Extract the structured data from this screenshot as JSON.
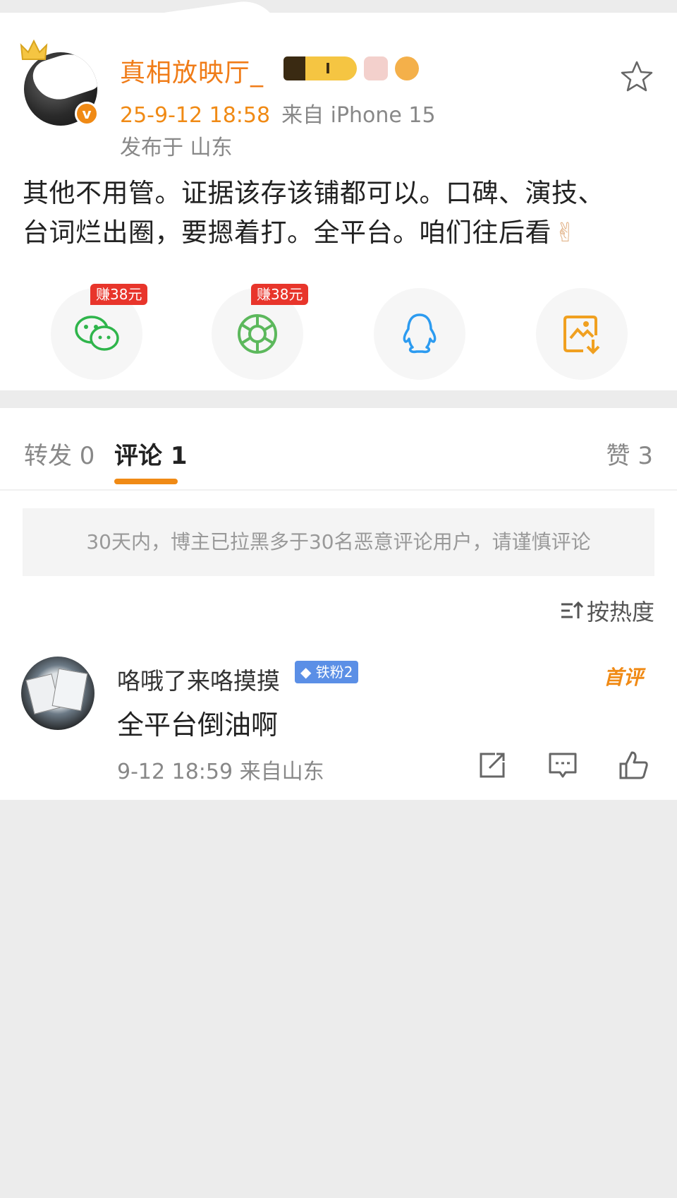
{
  "post": {
    "username": "真相放映厅_",
    "level_badge": "I",
    "verified_mark": "v",
    "time": "25-9-12 18:58",
    "source": "来自 iPhone 15",
    "location": "发布于 山东",
    "text_line1": "其他不用管。证据该存该铺都可以。口碑、演技、",
    "text_line2": "台词烂出圈，要摁着打。全平台。咱们往后看",
    "emoji": "✌"
  },
  "share": {
    "items": [
      {
        "icon": "wechat-icon",
        "tag": "赚38元"
      },
      {
        "icon": "moments-icon",
        "tag": "赚38元"
      },
      {
        "icon": "qq-icon",
        "tag": ""
      },
      {
        "icon": "save-image-icon",
        "tag": ""
      }
    ]
  },
  "tabs": {
    "repost": "转发 0",
    "comments": "评论 1",
    "likes": "赞 3"
  },
  "notice": "30天内，博主已拉黑多于30名恶意评论用户，请谨慎评论",
  "sort": {
    "icon": "sort-icon",
    "label": "按热度"
  },
  "comment": {
    "username": "咯哦了来咯摸摸",
    "fan_badge": "铁粉2",
    "first_tag": "首评",
    "text": "全平台倒油啊",
    "meta": "9-12 18:59  来自山东"
  },
  "colors": {
    "accent_orange": "#f08a15",
    "earn_red": "#e8352b",
    "fan_blue": "#5b8fe6",
    "background_gray": "#ececec"
  }
}
